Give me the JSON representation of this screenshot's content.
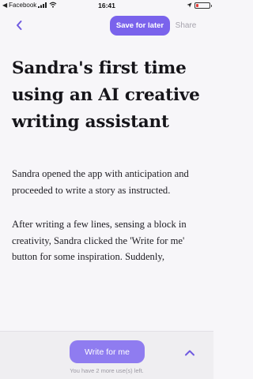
{
  "status_bar": {
    "back_indicator": "◀",
    "carrier": "Facebook",
    "time": "16:41",
    "battery_level": 0.18,
    "icons": [
      "signal-icon",
      "wifi-icon",
      "battery-icon"
    ]
  },
  "top_bar": {
    "back_icon": "chevron-left-icon",
    "save_label": "Save for later",
    "share_label": "Share"
  },
  "article": {
    "title": "Sandra's first time using an AI creative writing assistant",
    "paragraphs": [
      "Sandra opened the app with anticipation and proceeded to write a story as instructed.",
      "After writing a few lines, sensing a block in creativity, Sandra clicked the 'Write for me' button for some inspiration. Suddenly,"
    ]
  },
  "bottom_panel": {
    "write_label": "Write for me",
    "expand_icon": "chevron-up-icon",
    "uses_left": "You have 2 more use(s) left."
  },
  "colors": {
    "accent": "#7a63ec",
    "accent_light": "#8f7cf0",
    "background": "#f7f6f9",
    "panel": "#efeef1",
    "muted": "#a6a3ad"
  }
}
